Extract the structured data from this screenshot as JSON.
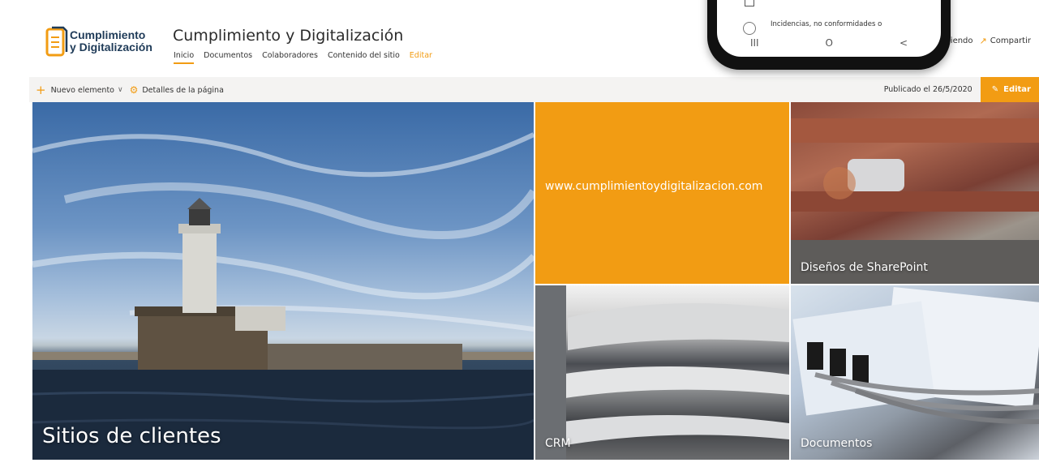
{
  "header": {
    "logo_line1": "Cumplimiento",
    "logo_line2": "y Digitalización",
    "site_title": "Cumplimiento y Digitalización",
    "nav": [
      "Inicio",
      "Documentos",
      "Colaboradores",
      "Contenido del sitio",
      "Editar"
    ],
    "following_partial": "uiendo",
    "share_label": "Compartir"
  },
  "commandbar": {
    "new_item": "Nuevo elemento",
    "page_details": "Detalles de la página",
    "published": "Publicado el 26/5/2020",
    "edit": "Editar"
  },
  "hero": {
    "main_caption": "Sitios de clientes",
    "orange_text": "www.cumplimientoydigitalizacion.com",
    "sp_caption": "Diseños de SharePoint",
    "crm_caption": "CRM",
    "doc_caption": "Documentos"
  },
  "phone": {
    "item_text": "Incidencias, no conformidades o",
    "nav_recent": "III",
    "nav_home": "O",
    "nav_back": "<"
  },
  "colors": {
    "accent": "#f29c13",
    "logo_text": "#1f3b58"
  }
}
